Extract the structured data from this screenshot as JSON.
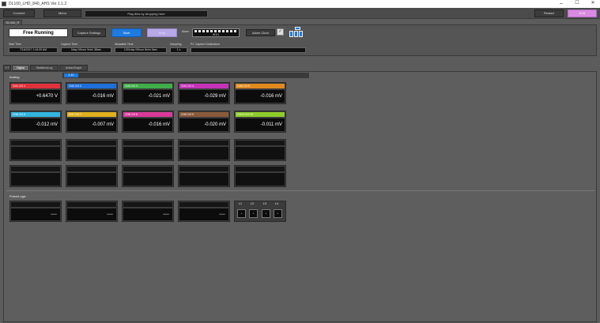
{
  "window": {
    "title": "DL100_LHD_840_AHS Ver 1.1.2",
    "minimize": "–",
    "maximize": "☐",
    "close": "✕"
  },
  "toolbar": {
    "connect_label": "Connect",
    "menu_label": "Menu",
    "message": "Play files by dropping here",
    "restart_label": "Restart",
    "exit_label": "Exit"
  },
  "device_tab": "DL340_R",
  "controls": {
    "status": "Free Running",
    "capture_settings_label": "Capture Settings",
    "start_label": "Start",
    "stop_label": "Stop",
    "alarm_label": "Alarm",
    "alarm_value": "W1/1",
    "alarm_clear_label": "Alarm Clear",
    "alarm_clear_check": "✓"
  },
  "info": {
    "start_time_label": "Start Time",
    "start_time": "7/16/2017 1:44:09 AM",
    "capture_time_label": "Capture Time",
    "capture_time": "0day 00hour 9min 38sec",
    "allowable_time_label": "Allowable Time",
    "allowable_time": "1001day 09hour 8min 0sec",
    "sampling_label": "Sampling",
    "sampling": "1 s",
    "destination_label": "PC Capture Destination",
    "destination": ""
  },
  "tabs": [
    "Y-T",
    "Digital",
    "Statistics/Log",
    "Action/Graph"
  ],
  "subtab": "1-10",
  "analog_label": "Analog",
  "channels": [
    {
      "label": "CH1  CH 1",
      "value": "+0.6470 V",
      "color": "#e0323c"
    },
    {
      "label": "CH2  CH 2",
      "value": "-0.016 mV",
      "color": "#1e6fd9"
    },
    {
      "label": "CH3  CH 3",
      "value": "-0.021 mV",
      "color": "#3fae49"
    },
    {
      "label": "CH4  CH 4",
      "value": "-0.029 mV",
      "color": "#c433b8"
    },
    {
      "label": "CH5  CH 5",
      "value": "-0.016 mV",
      "color": "#e08a1e"
    },
    {
      "label": "CH6  CH 6",
      "value": "-0.012 mV",
      "color": "#33b5e0"
    },
    {
      "label": "CH7  CH 7",
      "value": "-0.007 mV",
      "color": "#e0b01e"
    },
    {
      "label": "CH8  CH 8",
      "value": "-0.016 mV",
      "color": "#d93a9a"
    },
    {
      "label": "CH9  CH 9",
      "value": "-0.020 mV",
      "color": "#8a5a3a"
    },
    {
      "label": "CH10  CH 10",
      "value": "-0.011 mV",
      "color": "#8fcc2a"
    }
  ],
  "pulse_logic_label": "Pulse/Logic",
  "pulses": [
    "*****",
    "*****",
    "*****",
    "*****"
  ],
  "logic": {
    "labels": [
      "L1",
      "L2",
      "L3",
      "L4"
    ],
    "values": [
      "*",
      "*",
      "*",
      "*"
    ]
  }
}
